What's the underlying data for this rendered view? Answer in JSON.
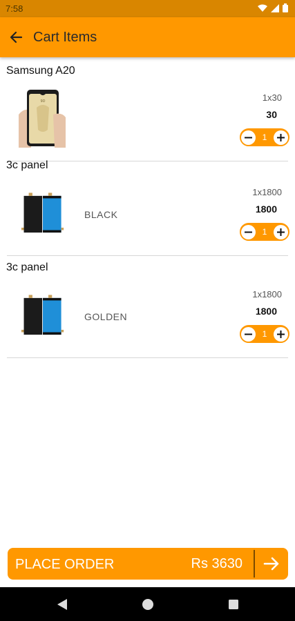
{
  "status_bar": {
    "time": "7:58"
  },
  "app_bar": {
    "title": "Cart Items"
  },
  "cart": {
    "items": [
      {
        "name": "Samsung A20",
        "variant": "",
        "unit_price": "1x30",
        "total": "30",
        "quantity": "1",
        "image": "phone-screen-protector"
      },
      {
        "name": "3c panel",
        "variant": "BLACK",
        "unit_price": "1x1800",
        "total": "1800",
        "quantity": "1",
        "image": "display-panel"
      },
      {
        "name": "3c panel",
        "variant": "GOLDEN",
        "unit_price": "1x1800",
        "total": "1800",
        "quantity": "1",
        "image": "display-panel"
      }
    ]
  },
  "footer": {
    "place_order_label": "PLACE ORDER",
    "total": "Rs 3630"
  },
  "colors": {
    "accent": "#ff9800",
    "status_bar": "#d98600",
    "nav_bar": "#000000"
  },
  "icons": [
    "wifi-icon",
    "signal-icon",
    "battery-icon",
    "back-arrow-icon",
    "minus-icon",
    "plus-icon",
    "forward-arrow-icon",
    "nav-back-icon",
    "nav-home-icon",
    "nav-recents-icon"
  ]
}
